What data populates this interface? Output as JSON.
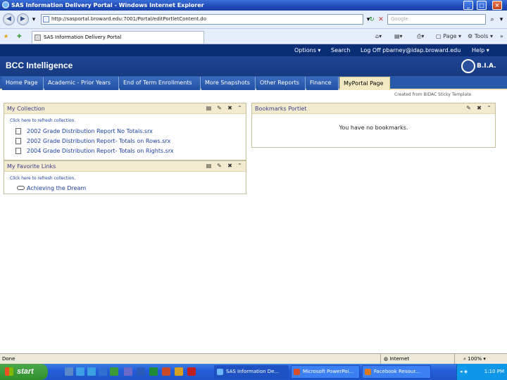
{
  "window": {
    "title": "SAS Information Delivery Portal - Windows Internet Explorer",
    "min": "_",
    "max": "□",
    "close": "×"
  },
  "browser": {
    "back_glyph": "◀",
    "forward_glyph": "▶",
    "address": "http://sasportal.broward.edu:7001/Portal/editPortletContent.do",
    "search_placeholder": "Google",
    "tab_title": "SAS Information Delivery Portal",
    "page_menu": "Page",
    "tools_menu": "Tools"
  },
  "app": {
    "links": [
      "Options",
      "Search",
      "Log Off pbarney@idap.broward.edu",
      "Help"
    ],
    "title": "BCC Intelligence",
    "logo_text": "B.I.A."
  },
  "portal_tabs": [
    {
      "label": "Home Page",
      "active": false
    },
    {
      "label": "Academic - Prior Years",
      "active": false
    },
    {
      "label": "End of Term Enrollments",
      "active": false
    },
    {
      "label": "More Snapshots",
      "active": false
    },
    {
      "label": "Other Reports",
      "active": false
    },
    {
      "label": "Finance",
      "active": false
    },
    {
      "label": "MyPortal Page",
      "active": true
    }
  ],
  "template_note": "Created from BIDAC Sticky Template",
  "portlets": {
    "collection": {
      "title": "My Collection",
      "refresh": "Click here to refresh collection.",
      "items": [
        "2002 Grade Distribution Report No Totals.srx",
        "2002 Grade Distribution Report- Totals on Rows.srx",
        "2004 Grade Distribution Report- Totals on Rights.srx"
      ]
    },
    "favorites": {
      "title": "My Favorite Links",
      "refresh": "Click here to refresh collection.",
      "items": [
        "Achieving the Dream"
      ]
    },
    "bookmarks": {
      "title": "Bookmarks Portlet",
      "empty": "You have no bookmarks."
    }
  },
  "status": {
    "text": "Done",
    "zone": "Internet",
    "zoom": "100%"
  },
  "taskbar": {
    "start": "start",
    "tasks": [
      {
        "label": "SAS Information De...",
        "active": true
      },
      {
        "label": "Microsoft PowerPoi...",
        "active": false
      },
      {
        "label": "Facebook Resour...",
        "active": false
      }
    ],
    "clock": "1:10 PM"
  }
}
